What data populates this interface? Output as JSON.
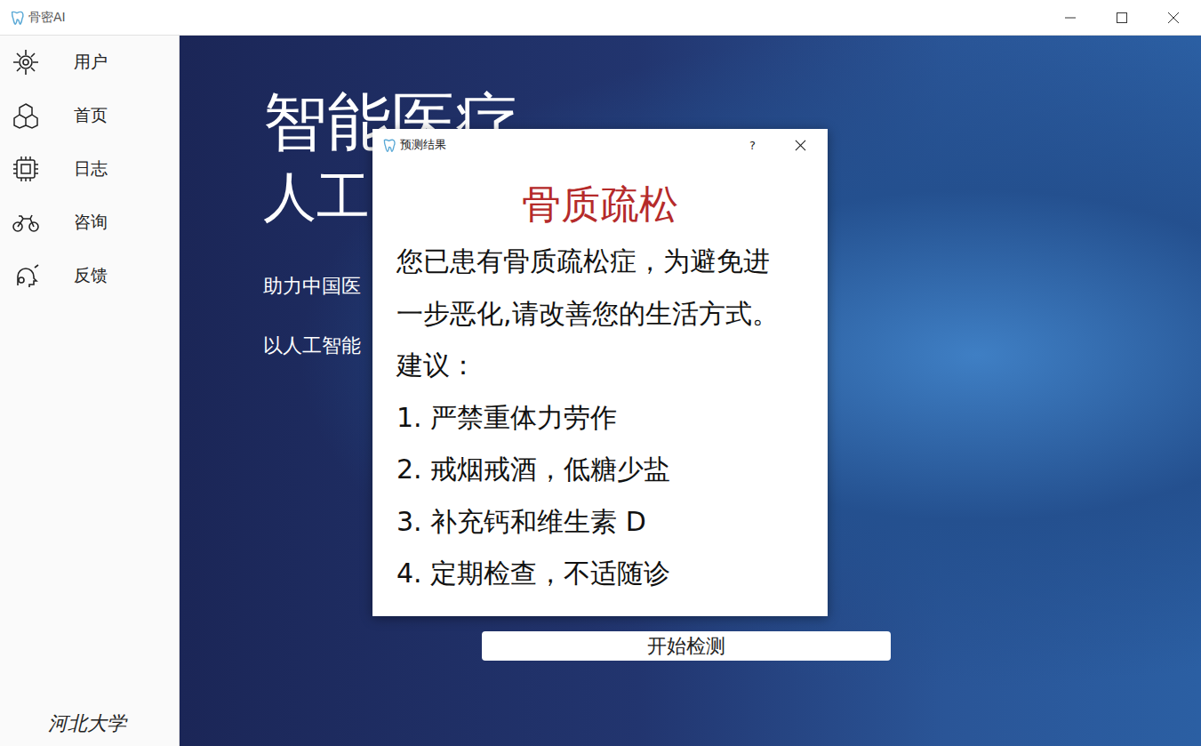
{
  "window": {
    "title": "骨密AI"
  },
  "sidebar": {
    "items": [
      {
        "label": "用户",
        "icon": "gear"
      },
      {
        "label": "首页",
        "icon": "cubes"
      },
      {
        "label": "日志",
        "icon": "chip"
      },
      {
        "label": "咨询",
        "icon": "bike"
      },
      {
        "label": "反馈",
        "icon": "brain"
      }
    ],
    "footer": "河北大学"
  },
  "hero": {
    "headline": "智能医疗",
    "subline": "人工",
    "lines": [
      "助力中国医",
      "以人工智能"
    ]
  },
  "start_button": "开始检测",
  "dialog": {
    "title": "预测结果",
    "help": "?",
    "diagnosis": "骨质疏松",
    "message": [
      "您已患有骨质疏松症，为避免进",
      "一步恶化,请改善您的生活方式。"
    ],
    "advice_label": "建议：",
    "advice": [
      "1. 严禁重体力劳作",
      "2. 戒烟戒酒，低糖少盐",
      "3. 补充钙和维生素 D",
      "4. 定期检查，不适随诊"
    ]
  }
}
